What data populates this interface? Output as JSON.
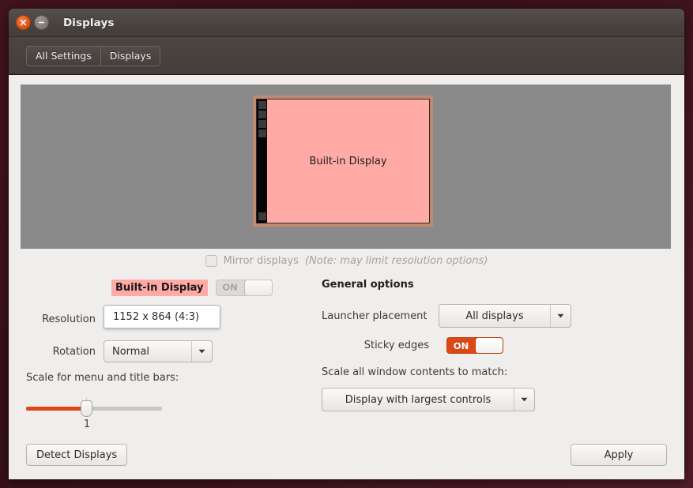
{
  "window": {
    "title": "Displays",
    "close_icon": "close-icon",
    "minimize_icon": "minimize-icon"
  },
  "toolbar": {
    "buttons": [
      {
        "label": "All Settings"
      },
      {
        "label": "Displays"
      }
    ]
  },
  "preview": {
    "monitor_label": "Built-in Display",
    "launcher_icon_count_top": 4,
    "launcher_icon_count_bottom": 1,
    "canvas_color": "#8a8a8a",
    "screen_color": "#ffaaa5",
    "frame_color": "#c08a72"
  },
  "mirror": {
    "label": "Mirror displays",
    "note": "(Note: may limit resolution options)",
    "checked": false,
    "enabled": false
  },
  "display_options": {
    "name": "Built-in Display",
    "name_highlight_color": "#ffaaa5",
    "power_toggle": {
      "label": "ON",
      "state": "on",
      "enabled": false
    },
    "resolution": {
      "label": "Resolution",
      "value": "1152 x 864 (4:3)"
    },
    "rotation": {
      "label": "Rotation",
      "value": "Normal"
    },
    "scale_menu": {
      "label": "Scale for menu and title bars:",
      "value": "1",
      "fill_color": "#dd4814"
    }
  },
  "general": {
    "title": "General options",
    "launcher_placement": {
      "label": "Launcher placement",
      "value": "All displays"
    },
    "sticky_edges": {
      "label": "Sticky edges",
      "toggle_label": "ON",
      "state": "on",
      "accent_color": "#dd4814"
    },
    "scale_all": {
      "label": "Scale all window contents to match:",
      "value": "Display with largest controls"
    }
  },
  "actions": {
    "detect": "Detect Displays",
    "apply": "Apply"
  }
}
